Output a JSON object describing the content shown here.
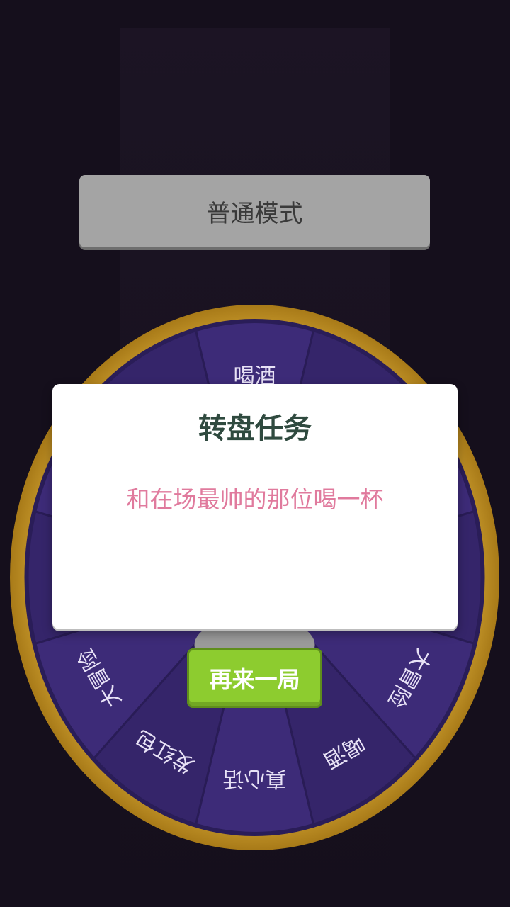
{
  "mode_button": {
    "label": "普通模式"
  },
  "wheel": {
    "segments": [
      {
        "label": "喝酒",
        "angle": 0
      },
      {
        "label": "大冒险",
        "angle": 120
      },
      {
        "label": "喝酒",
        "angle": 150
      },
      {
        "label": "真心话",
        "angle": 180
      },
      {
        "label": "发红包",
        "angle": 210
      },
      {
        "label": "大冒险",
        "angle": 240
      }
    ]
  },
  "dialog": {
    "title": "转盘任务",
    "message": "和在场最帅的那位喝一杯",
    "action_label": "再来一局"
  }
}
